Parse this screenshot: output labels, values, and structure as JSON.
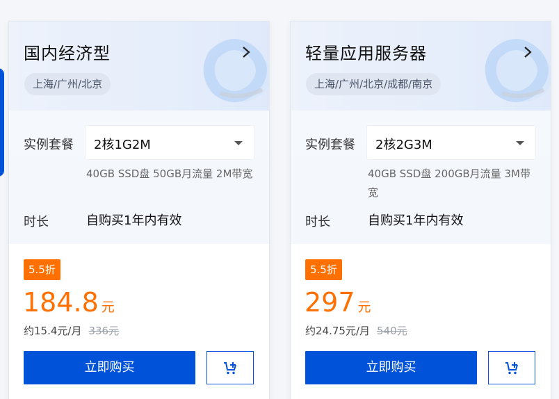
{
  "cards": [
    {
      "title": "国内经济型",
      "regions": "上海/广州/北京",
      "spec_label": "实例套餐",
      "spec_value": "2核1G2M",
      "spec_desc": "40GB SSD盘 50GB月流量 2M带宽",
      "duration_label": "时长",
      "duration_value": "自购买1年内有效",
      "discount": "5.5折",
      "price": "184.8",
      "price_unit": "元",
      "monthly": "约15.4元/月",
      "original_price": "336元",
      "buy_label": "立即购买"
    },
    {
      "title": "轻量应用服务器",
      "regions": "上海/广州/北京/成都/南京",
      "spec_label": "实例套餐",
      "spec_value": "2核2G3M",
      "spec_desc": "40GB SSD盘 200GB月流量 3M带宽",
      "duration_label": "时长",
      "duration_value": "自购买1年内有效",
      "discount": "5.5折",
      "price": "297",
      "price_unit": "元",
      "monthly": "约24.75元/月",
      "original_price": "540元",
      "buy_label": "立即购买"
    }
  ],
  "icons": {
    "chevron": "chevron-right-icon",
    "caret": "caret-down-icon",
    "cart": "add-to-cart-icon"
  },
  "colors": {
    "primary": "#0052d9",
    "price": "#ff7000",
    "discount_bg": "#ff7000"
  }
}
